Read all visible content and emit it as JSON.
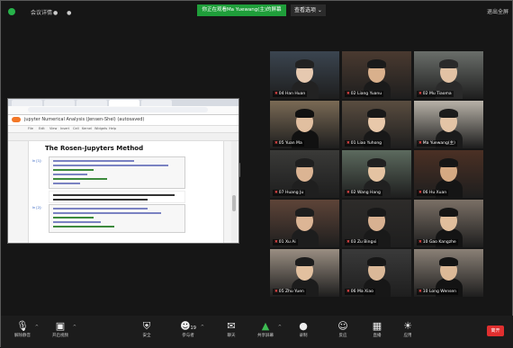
{
  "topbar": {
    "meeting_label": "会议详情",
    "share_banner": "你正在观看Ma Yuewang(主)的屏幕",
    "view_options": "查看选项 ⌄",
    "window_controls": "退出全屏"
  },
  "shared_screen": {
    "notebook_title": "jupyter  Numerical Analysis (Jensen-Shel) (autosaved)",
    "markdown_heading": "The Rosen-Jupyters Method",
    "menu": [
      "File",
      "Edit",
      "View",
      "Insert",
      "Cell",
      "Kernel",
      "Widgets",
      "Help"
    ],
    "cell_prompts": [
      "In [1]:",
      "In [2]:",
      "In [3]:"
    ]
  },
  "participants": [
    {
      "name": "04 Han Huan"
    },
    {
      "name": "02 Liang Yuanu"
    },
    {
      "name": "02 Mu Tiaoma"
    },
    {
      "name": "05 Yuan Ma"
    },
    {
      "name": "01 Liao Yuhong"
    },
    {
      "name": "Ma Yuewang(主)"
    },
    {
      "name": "07 Huang Ju"
    },
    {
      "name": "02 Wang Hang"
    },
    {
      "name": "06 Hu Xuan"
    },
    {
      "name": "01 Xu Ai"
    },
    {
      "name": "03 Zu Bingxi"
    },
    {
      "name": "10 Gao Kangzhe"
    },
    {
      "name": "05 Zhu Yuen"
    },
    {
      "name": "06 Ma Xiao"
    },
    {
      "name": "10 Long Wensen"
    }
  ],
  "toolbar": {
    "mute": "解除静音",
    "video": "开启视频",
    "security": "安全",
    "participants": "参与者",
    "participants_count": "19",
    "chat": "聊天",
    "share": "共享屏幕",
    "record": "录制",
    "reactions": "反应",
    "live": "直播",
    "apps": "应用",
    "end": "离开"
  },
  "colors": {
    "share_banner": "#1f9e3a",
    "active_speaker": "#9bd34a",
    "end_button": "#e02f2f"
  }
}
